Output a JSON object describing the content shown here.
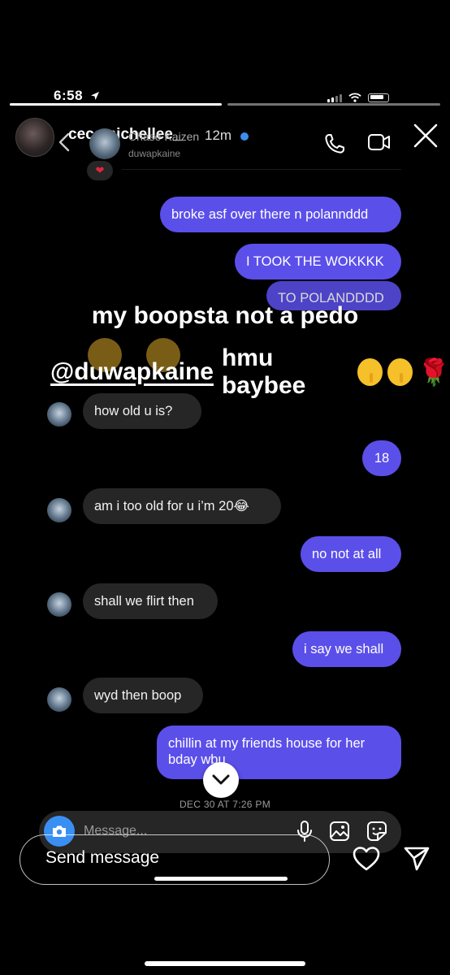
{
  "status_bar": {
    "time": "6:58"
  },
  "story": {
    "username": "cecemichellee_",
    "time_ago": "12m",
    "overlay_line1": "my boopsta not a pedo",
    "overlay_mention": "@duwapkaine",
    "overlay_line2_rest": "hmu baybee",
    "reply_placeholder": "Send message"
  },
  "dm_header": {
    "name": "Chase Kaizen",
    "username": "duwapkaine"
  },
  "messages": [
    {
      "side": "out",
      "text": "broke asf over there n polannddd"
    },
    {
      "side": "out",
      "text": "I TOOK THE WOKKKK"
    },
    {
      "side": "out",
      "text": "TO POLANDDDD"
    },
    {
      "side": "in",
      "text": "how old u is?"
    },
    {
      "side": "out",
      "text": "18"
    },
    {
      "side": "in",
      "text": "am i too old for u i’m 20😂"
    },
    {
      "side": "out",
      "text": "no not at all"
    },
    {
      "side": "in",
      "text": "shall we flirt then"
    },
    {
      "side": "out",
      "text": "i say we shall"
    },
    {
      "side": "in",
      "text": "wyd then boop"
    },
    {
      "side": "out",
      "text": "chillin at my friends house for her bday wbu"
    }
  ],
  "timestamp": "DEC 30 AT 7:26 PM",
  "composer": {
    "placeholder": "Message..."
  },
  "colors": {
    "outgoing_bubble": "#5b4fea",
    "incoming_bubble": "#262626",
    "camera_button": "#3a8ff2"
  },
  "icons": [
    "location-arrow-icon",
    "signal-icon",
    "wifi-icon",
    "battery-icon",
    "close-icon",
    "back-chevron-icon",
    "verified-badge-icon",
    "phone-icon",
    "video-camera-icon",
    "heart-reaction-icon",
    "chevron-down-icon",
    "camera-icon",
    "microphone-icon",
    "gallery-icon",
    "sticker-icon",
    "heart-icon",
    "send-icon"
  ]
}
